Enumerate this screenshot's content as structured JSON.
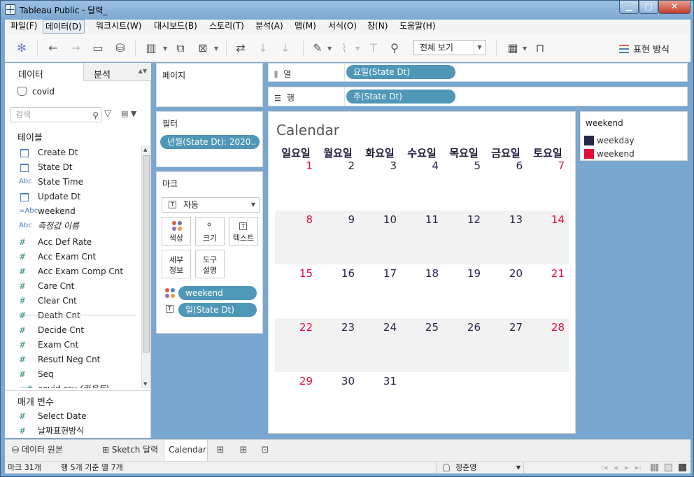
{
  "window": {
    "title": "Tableau Public - 달력_"
  },
  "menu": [
    "파일(F)",
    "데이터(D)",
    "워크시트(W)",
    "대시보드(B)",
    "스토리(T)",
    "분석(A)",
    "맵(M)",
    "서식(O)",
    "창(N)",
    "도움말(H)"
  ],
  "toolbar": {
    "view_select": "전체 보기",
    "show_me": "표현 방식"
  },
  "data_pane": {
    "tab_data": "데이터",
    "tab_analysis": "분석",
    "datasource": "covid",
    "search_placeholder": "검색",
    "tables_header": "테이블",
    "fields": [
      {
        "icon": "Abc-cal",
        "name": "Create Dt"
      },
      {
        "icon": "cal",
        "name": "State Dt"
      },
      {
        "icon": "Abc",
        "name": "State Time"
      },
      {
        "icon": "Abc-cal",
        "name": "Update Dt"
      },
      {
        "icon": "=Abc",
        "name": "weekend"
      },
      {
        "icon": "Abc",
        "name": "측정값 이름"
      },
      {
        "icon": "#",
        "name": "Acc Def Rate"
      },
      {
        "icon": "#",
        "name": "Acc Exam Cnt"
      },
      {
        "icon": "#",
        "name": "Acc Exam Comp Cnt"
      },
      {
        "icon": "#",
        "name": "Care Cnt"
      },
      {
        "icon": "#",
        "name": "Clear Cnt"
      },
      {
        "icon": "#",
        "name": "Death Cnt"
      },
      {
        "icon": "#",
        "name": "Decide Cnt"
      },
      {
        "icon": "#",
        "name": "Exam Cnt"
      },
      {
        "icon": "#",
        "name": "Resutl Neg Cnt"
      },
      {
        "icon": "#",
        "name": "Seq"
      },
      {
        "icon": "=#",
        "name": "covid.csv (카운트)"
      }
    ],
    "params_header": "매개 변수",
    "params": [
      {
        "icon": "#",
        "name": "Select Date"
      },
      {
        "icon": "#",
        "name": "날짜표현방식"
      }
    ]
  },
  "shelves": {
    "pages": "페이지",
    "filters": "필터",
    "filter_pill": "년월(State Dt): 2020..",
    "marks": "마크",
    "mark_type": "자동",
    "mark_buttons": {
      "color": "색상",
      "size": "크기",
      "text": "텍스트",
      "detail": "세부\n정보",
      "tooltip": "도구\n설명"
    },
    "mark_pills": [
      {
        "type": "color",
        "label": "weekend"
      },
      {
        "type": "text",
        "label": "일(State Dt)"
      }
    ],
    "columns_label": "열",
    "columns_pill": "요일(State Dt)",
    "rows_label": "행",
    "rows_pill": "주(State Dt)"
  },
  "view": {
    "title": "Calendar",
    "weekdays": [
      "일요일",
      "월요일",
      "화요일",
      "수요일",
      "목요일",
      "금요일",
      "토요일"
    ],
    "weeks": [
      [
        1,
        2,
        3,
        4,
        5,
        6,
        7
      ],
      [
        8,
        9,
        10,
        11,
        12,
        13,
        14
      ],
      [
        15,
        16,
        17,
        18,
        19,
        20,
        21
      ],
      [
        22,
        23,
        24,
        25,
        26,
        27,
        28
      ],
      [
        29,
        30,
        31,
        null,
        null,
        null,
        null
      ]
    ],
    "weekend_columns": [
      0,
      6
    ]
  },
  "legend": {
    "title": "weekend",
    "items": [
      {
        "label": "weekday",
        "color": "#262649"
      },
      {
        "label": "weekend",
        "color": "#e0103a"
      }
    ]
  },
  "sheet_tabs": {
    "datasource": "데이터 원본",
    "sheets": [
      {
        "label": "Sketch 달력",
        "active": false
      },
      {
        "label": "Calendar",
        "active": true
      }
    ]
  },
  "status": {
    "marks": "마크 31개",
    "rows_cols": "행 5개 기준 열 7개",
    "user": "정준영"
  }
}
